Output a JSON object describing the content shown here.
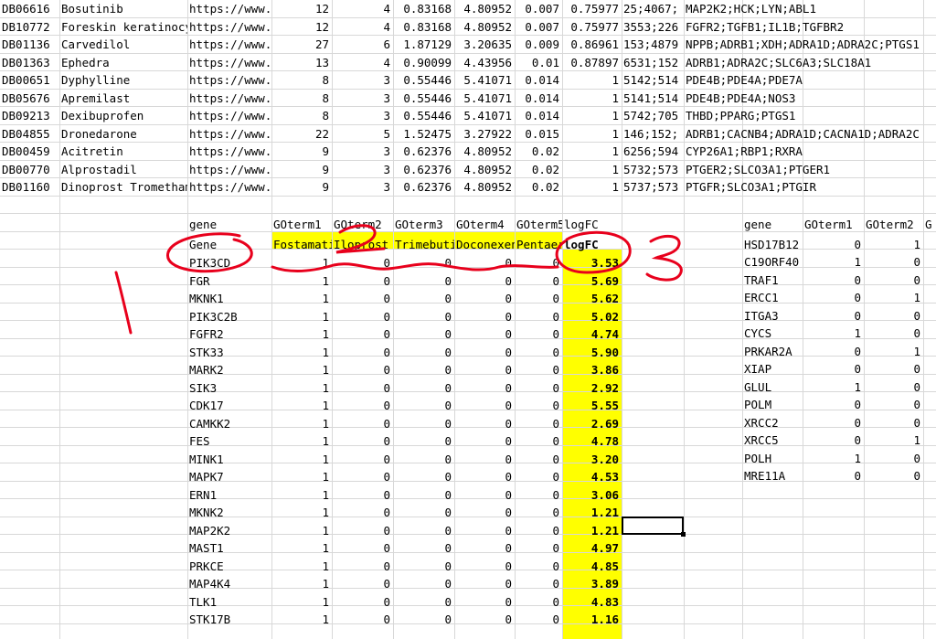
{
  "drug_rows": [
    {
      "id": "DB06616",
      "name": "Bosutinib",
      "link": "https://www.",
      "c1": "12",
      "c2": "4",
      "c3": "0.83168",
      "c4": "4.80952",
      "c5": "0.007",
      "c6": "0.75977",
      "c7": "25;4067;",
      "c8": "MAP2K2;HCK;LYN;ABL1"
    },
    {
      "id": "DB10772",
      "name": "Foreskin keratinocyte",
      "link": "https://www.",
      "c1": "12",
      "c2": "4",
      "c3": "0.83168",
      "c4": "4.80952",
      "c5": "0.007",
      "c6": "0.75977",
      "c7": "3553;226",
      "c8": "FGFR2;TGFB1;IL1B;TGFBR2"
    },
    {
      "id": "DB01136",
      "name": "Carvedilol",
      "link": "https://www.",
      "c1": "27",
      "c2": "6",
      "c3": "1.87129",
      "c4": "3.20635",
      "c5": "0.009",
      "c6": "0.86961",
      "c7": "153;4879",
      "c8": "NPPB;ADRB1;XDH;ADRA1D;ADRA2C;PTGS1"
    },
    {
      "id": "DB01363",
      "name": "Ephedra",
      "link": "https://www.",
      "c1": "13",
      "c2": "4",
      "c3": "0.90099",
      "c4": "4.43956",
      "c5": "0.01",
      "c6": "0.87897",
      "c7": "6531;152",
      "c8": "ADRB1;ADRA2C;SLC6A3;SLC18A1"
    },
    {
      "id": "DB00651",
      "name": "Dyphylline",
      "link": "https://www.",
      "c1": "8",
      "c2": "3",
      "c3": "0.55446",
      "c4": "5.41071",
      "c5": "0.014",
      "c6": "1",
      "c7": "5142;514",
      "c8": "PDE4B;PDE4A;PDE7A"
    },
    {
      "id": "DB05676",
      "name": "Apremilast",
      "link": "https://www.",
      "c1": "8",
      "c2": "3",
      "c3": "0.55446",
      "c4": "5.41071",
      "c5": "0.014",
      "c6": "1",
      "c7": "5141;514",
      "c8": "PDE4B;PDE4A;NOS3"
    },
    {
      "id": "DB09213",
      "name": "Dexibuprofen",
      "link": "https://www.",
      "c1": "8",
      "c2": "3",
      "c3": "0.55446",
      "c4": "5.41071",
      "c5": "0.014",
      "c6": "1",
      "c7": "5742;705",
      "c8": "THBD;PPARG;PTGS1"
    },
    {
      "id": "DB04855",
      "name": "Dronedarone",
      "link": "https://www.",
      "c1": "22",
      "c2": "5",
      "c3": "1.52475",
      "c4": "3.27922",
      "c5": "0.015",
      "c6": "1",
      "c7": "146;152;",
      "c8": "ADRB1;CACNB4;ADRA1D;CACNA1D;ADRA2C"
    },
    {
      "id": "DB00459",
      "name": "Acitretin",
      "link": "https://www.",
      "c1": "9",
      "c2": "3",
      "c3": "0.62376",
      "c4": "4.80952",
      "c5": "0.02",
      "c6": "1",
      "c7": "6256;594",
      "c8": "CYP26A1;RBP1;RXRA"
    },
    {
      "id": "DB00770",
      "name": "Alprostadil",
      "link": "https://www.",
      "c1": "9",
      "c2": "3",
      "c3": "0.62376",
      "c4": "4.80952",
      "c5": "0.02",
      "c6": "1",
      "c7": "5732;573",
      "c8": "PTGER2;SLCO3A1;PTGER1"
    },
    {
      "id": "DB01160",
      "name": "Dinoprost Tromethamine",
      "link": "https://www.",
      "c1": "9",
      "c2": "3",
      "c3": "0.62376",
      "c4": "4.80952",
      "c5": "0.02",
      "c6": "1",
      "c7": "5737;573",
      "c8": "PTGFR;SLCO3A1;PTGIR"
    }
  ],
  "mid_header": [
    "gene",
    "GOterm1",
    "GOterm2",
    "GOterm3",
    "GOterm4",
    "GOterm5",
    "logFC"
  ],
  "mid_header2": [
    "Gene",
    "Fostamatinib",
    "Iloprost",
    "Trimebutine",
    "Doconexent",
    "Pentaerythritol",
    "logFC"
  ],
  "mid_rows": [
    [
      "PIK3CD",
      "1",
      "0",
      "0",
      "0",
      "0",
      "3.53"
    ],
    [
      "FGR",
      "1",
      "0",
      "0",
      "0",
      "0",
      "5.69"
    ],
    [
      "MKNK1",
      "1",
      "0",
      "0",
      "0",
      "0",
      "5.62"
    ],
    [
      "PIK3C2B",
      "1",
      "0",
      "0",
      "0",
      "0",
      "5.02"
    ],
    [
      "FGFR2",
      "1",
      "0",
      "0",
      "0",
      "0",
      "4.74"
    ],
    [
      "STK33",
      "1",
      "0",
      "0",
      "0",
      "0",
      "5.90"
    ],
    [
      "MARK2",
      "1",
      "0",
      "0",
      "0",
      "0",
      "3.86"
    ],
    [
      "SIK3",
      "1",
      "0",
      "0",
      "0",
      "0",
      "2.92"
    ],
    [
      "CDK17",
      "1",
      "0",
      "0",
      "0",
      "0",
      "5.55"
    ],
    [
      "CAMKK2",
      "1",
      "0",
      "0",
      "0",
      "0",
      "2.69"
    ],
    [
      "FES",
      "1",
      "0",
      "0",
      "0",
      "0",
      "4.78"
    ],
    [
      "MINK1",
      "1",
      "0",
      "0",
      "0",
      "0",
      "3.20"
    ],
    [
      "MAPK7",
      "1",
      "0",
      "0",
      "0",
      "0",
      "4.53"
    ],
    [
      "ERN1",
      "1",
      "0",
      "0",
      "0",
      "0",
      "3.06"
    ],
    [
      "MKNK2",
      "1",
      "0",
      "0",
      "0",
      "0",
      "1.21"
    ],
    [
      "MAP2K2",
      "1",
      "0",
      "0",
      "0",
      "0",
      "1.21"
    ],
    [
      "MAST1",
      "1",
      "0",
      "0",
      "0",
      "0",
      "4.97"
    ],
    [
      "PRKCE",
      "1",
      "0",
      "0",
      "0",
      "0",
      "4.85"
    ],
    [
      "MAP4K4",
      "1",
      "0",
      "0",
      "0",
      "0",
      "3.89"
    ],
    [
      "TLK1",
      "1",
      "0",
      "0",
      "0",
      "0",
      "4.83"
    ],
    [
      "STK17B",
      "1",
      "0",
      "0",
      "0",
      "0",
      "1.16"
    ]
  ],
  "right_header": [
    "gene",
    "GOterm1",
    "GOterm2",
    "G"
  ],
  "right_rows": [
    [
      "HSD17B12",
      "0",
      "1"
    ],
    [
      "C19ORF40",
      "1",
      "0"
    ],
    [
      "TRAF1",
      "0",
      "0"
    ],
    [
      "ERCC1",
      "0",
      "1"
    ],
    [
      "ITGA3",
      "0",
      "0"
    ],
    [
      "CYCS",
      "1",
      "0"
    ],
    [
      "PRKAR2A",
      "0",
      "1"
    ],
    [
      "XIAP",
      "0",
      "0"
    ],
    [
      "GLUL",
      "1",
      "0"
    ],
    [
      "POLM",
      "0",
      "0"
    ],
    [
      "XRCC2",
      "0",
      "0"
    ],
    [
      "XRCC5",
      "0",
      "1"
    ],
    [
      "POLH",
      "1",
      "0"
    ],
    [
      "MRE11A",
      "0",
      "0"
    ]
  ],
  "annotation_color": "#e8001c",
  "highlight_color": "#ffff00"
}
